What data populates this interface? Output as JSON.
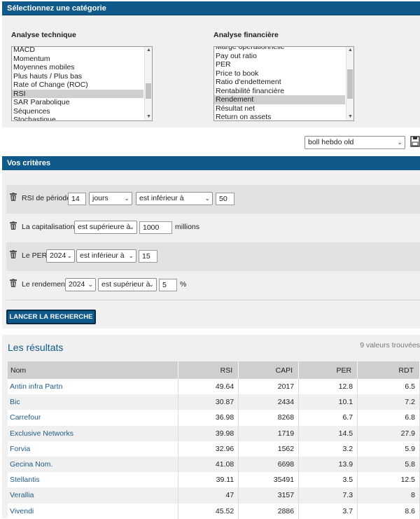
{
  "category": {
    "title": "Sélectionnez une catégorie",
    "technique": {
      "label": "Analyse technique",
      "options": [
        "MACD",
        "Momentum",
        "Moyennes mobiles",
        "Plus hauts / Plus bas",
        "Rate of Change (ROC)",
        "RSI",
        "SAR Parabolique",
        "Séquences",
        "Stochastique"
      ],
      "selected": "RSI"
    },
    "financiere": {
      "label": "Analyse financière",
      "options": [
        "Marge opérationnelle",
        "Pay out ratio",
        "PER",
        "Price to book",
        "Ratio d'endettement",
        "Rentabilité financière",
        "Rendement",
        "Résultat net",
        "Return on assets"
      ],
      "selected": "Rendement"
    }
  },
  "saved_search": {
    "value": "boll hebdo old",
    "icon": "save-icon"
  },
  "criteria": {
    "title": "Vos critères",
    "rows": [
      {
        "label": "RSI de période",
        "period": "14",
        "unit": "jours",
        "operator": "est inférieur à",
        "value": "50"
      },
      {
        "label": "La capitalisation",
        "operator": "est supérieure à",
        "value": "1000",
        "suffix": "millions"
      },
      {
        "label": "Le PER",
        "year": "2024",
        "operator": "est inférieur à",
        "value": "15"
      },
      {
        "label": "Le rendement",
        "year": "2024",
        "operator": "est supérieur à",
        "value": "5",
        "suffix": "%"
      }
    ],
    "launch_label": "LANCER LA RECHERCHE"
  },
  "results": {
    "title": "Les résultats",
    "count": "9 valeurs trouvées",
    "columns": [
      "Nom",
      "RSI",
      "CAPI",
      "PER",
      "RDT"
    ],
    "rows": [
      [
        "Antin infra Partn",
        "49.64",
        "2017",
        "12.8",
        "6.5"
      ],
      [
        "Bic",
        "30.87",
        "2434",
        "10.1",
        "7.2"
      ],
      [
        "Carrefour",
        "36.98",
        "8268",
        "6.7",
        "6.8"
      ],
      [
        "Exclusive Networks",
        "39.98",
        "1719",
        "14.5",
        "27.9"
      ],
      [
        "Forvia",
        "32.96",
        "1562",
        "3.2",
        "5.9"
      ],
      [
        "Gecina Nom.",
        "41.08",
        "6698",
        "13.9",
        "5.8"
      ],
      [
        "Stellantis",
        "39.11",
        "35491",
        "3.5",
        "12.5"
      ],
      [
        "Verallia",
        "47",
        "3157",
        "7.3",
        "8"
      ],
      [
        "Vivendi",
        "45.52",
        "2886",
        "3.7",
        "8.6"
      ]
    ]
  },
  "colors": {
    "accent": "#0f5a8a",
    "panel": "#f0f0f0",
    "row_shade": "#e2e2e2",
    "link": "#1f5b88"
  }
}
